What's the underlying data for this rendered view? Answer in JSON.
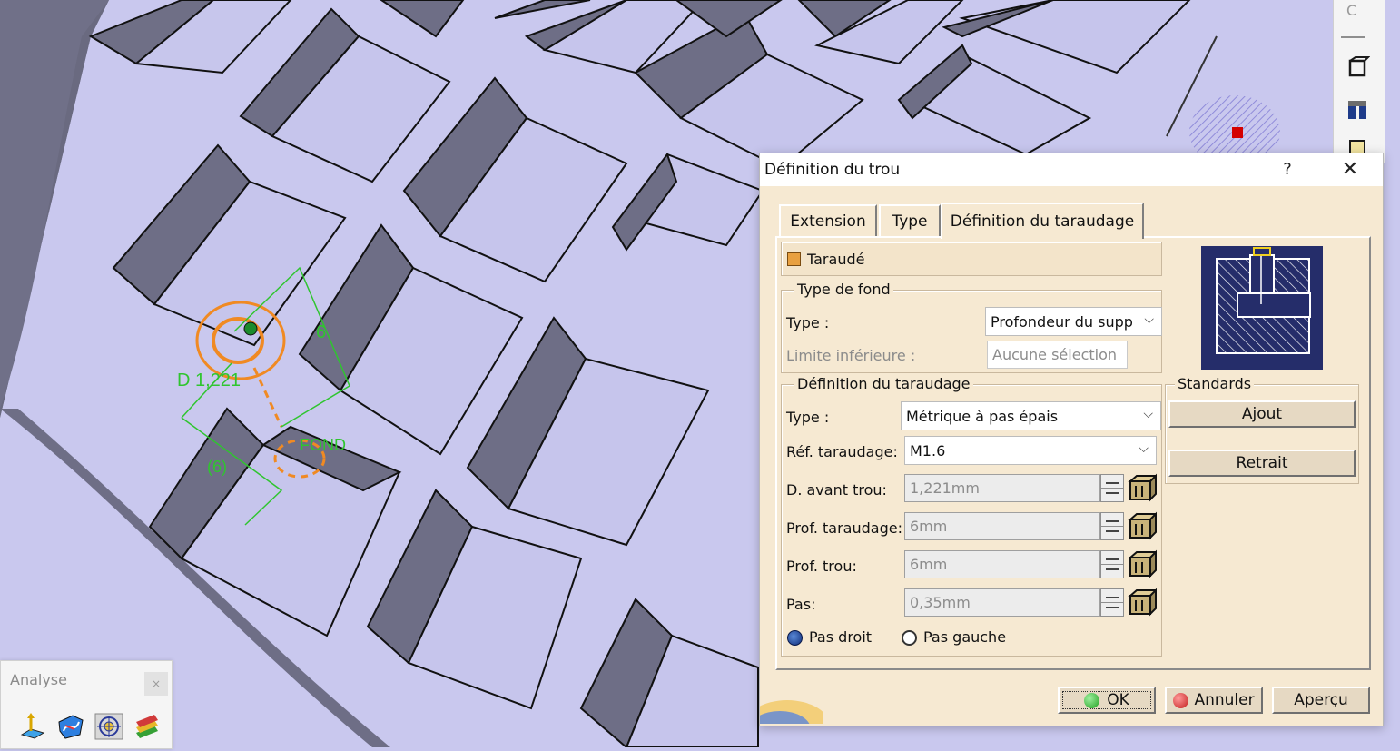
{
  "viewport": {
    "annotations": [
      "D 1,221",
      "6",
      "(6)",
      "FOND"
    ],
    "right_toolbar_label": "C"
  },
  "analyse_toolbar": {
    "title": "Analyse",
    "close": "×",
    "icons": [
      "draft-analysis-icon",
      "curvature-analysis-icon",
      "surface-analysis-icon",
      "thickness-analysis-icon"
    ]
  },
  "dialog": {
    "title": "Définition du trou",
    "help": "?",
    "close": "✕",
    "tabs": [
      {
        "label": "Extension",
        "active": false
      },
      {
        "label": "Type",
        "active": false
      },
      {
        "label": "Définition du taraudage",
        "active": true
      }
    ],
    "taraude": {
      "label": "Taraudé",
      "checked": true
    },
    "type_de_fond": {
      "group_label": "Type de fond",
      "type_label": "Type :",
      "type_value": "Profondeur du supp",
      "limite_label": "Limite inférieure :",
      "limite_value": "Aucune sélection"
    },
    "definition": {
      "group_label": "Définition du taraudage",
      "type_label": "Type :",
      "type_value": "Métrique à pas épais",
      "ref_label": "Réf. taraudage:",
      "ref_value": "M1.6",
      "fields": [
        {
          "label": "D. avant trou:",
          "value": "1,221mm"
        },
        {
          "label": "Prof. taraudage:",
          "value": "6mm"
        },
        {
          "label": "Prof. trou:",
          "value": "6mm"
        },
        {
          "label": "Pas:",
          "value": "0,35mm"
        }
      ],
      "radio_right": {
        "label": "Pas droit",
        "selected": true
      },
      "radio_left": {
        "label": "Pas gauche",
        "selected": false
      }
    },
    "standards": {
      "group_label": "Standards",
      "add": "Ajout",
      "remove": "Retrait"
    },
    "buttons": {
      "ok": "OK",
      "cancel": "Annuler",
      "preview": "Aperçu"
    },
    "colors": {
      "background": "#f6e9d2",
      "ok_green": "#2fb52f",
      "cancel_red": "#d12a2a",
      "preview_navy": "#20226a"
    }
  }
}
